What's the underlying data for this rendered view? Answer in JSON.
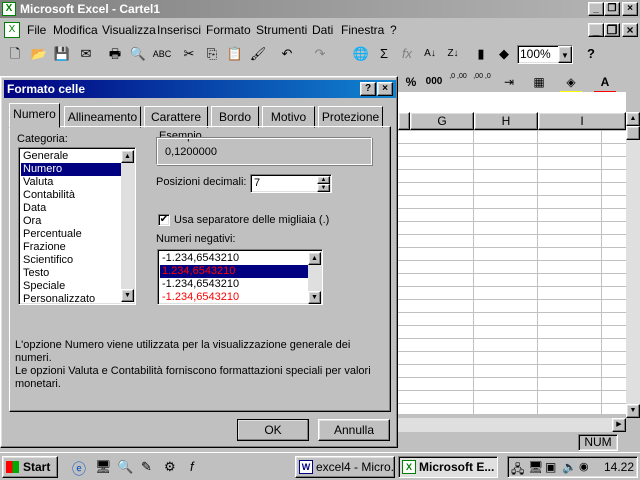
{
  "app": {
    "title": "Microsoft Excel - Cartel1"
  },
  "menu": [
    "File",
    "Modifica",
    "Visualizza",
    "Inserisci",
    "Formato",
    "Strumenti",
    "Dati",
    "Finestra",
    "?"
  ],
  "toolbar": {
    "zoom": "100%",
    "help": "?"
  },
  "format_toolbar": {
    "percent": "%",
    "thousands": "000",
    "inc_decimal": ",0 ,00",
    "dec_decimal": ",00 ,0"
  },
  "sheet": {
    "columns": [
      "G",
      "H",
      "I"
    ]
  },
  "dialog": {
    "title": "Formato celle",
    "help": "?",
    "tabs": [
      "Numero",
      "Allineamento",
      "Carattere",
      "Bordo",
      "Motivo",
      "Protezione"
    ],
    "category_label": "Categoria:",
    "categories": [
      "Generale",
      "Numero",
      "Valuta",
      "Contabilità",
      "Data",
      "Ora",
      "Percentuale",
      "Frazione",
      "Scientifico",
      "Testo",
      "Speciale",
      "Personalizzato"
    ],
    "selected_category": "Numero",
    "sample_label": "Esempio",
    "sample_value": "0,1200000",
    "decimals_label": "Posizioni decimali:",
    "decimals_value": "7",
    "separator_label": "Usa separatore delle migliaia (.)",
    "separator_checked": true,
    "negatives_label": "Numeri negativi:",
    "negatives": [
      {
        "text": "-1.234,6543210",
        "color": "#000000"
      },
      {
        "text": "1.234,6543210",
        "color": "#ff0000"
      },
      {
        "text": "-1.234,6543210",
        "color": "#000000"
      },
      {
        "text": "-1.234,6543210",
        "color": "#ff0000"
      }
    ],
    "description_1": "L'opzione Numero viene utilizzata per la visualizzazione generale dei numeri.",
    "description_2": "Le opzioni Valuta e Contabilità forniscono formattazioni speciali per valori monetari.",
    "ok": "OK",
    "cancel": "Annulla"
  },
  "status": {
    "num": "NUM"
  },
  "taskbar": {
    "start": "Start",
    "tasks": [
      "excel4 - Micro...",
      "Microsoft E..."
    ],
    "time": "14.22"
  }
}
